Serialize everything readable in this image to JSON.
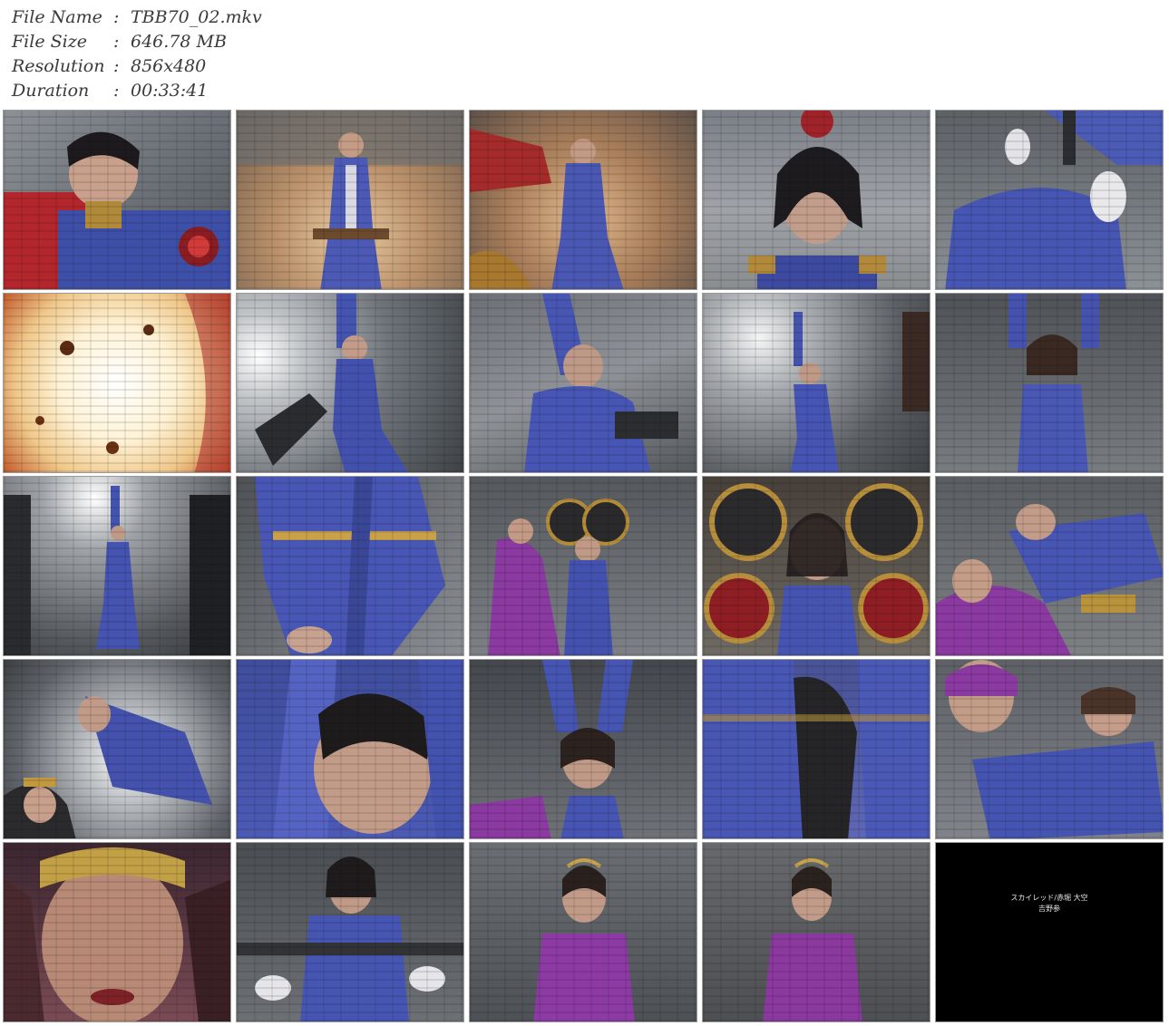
{
  "file_info": {
    "name_label": "File Name",
    "name_value": "TBB70_02.mkv",
    "size_label": "File Size",
    "size_value": "646.78 MB",
    "resolution_label": "Resolution",
    "resolution_value": "856x480",
    "duration_label": "Duration",
    "duration_value": "00:33:41",
    "separator": ":"
  },
  "final_frame_credit": {
    "line1": "スカイレッド/赤堀 大空",
    "line2": "吉野参"
  },
  "colors": {
    "suit_blue": "#4a5ab8",
    "villain_purple": "#8a3aa0",
    "villain_red": "#b02828",
    "wall_gray": "#6b6e72",
    "background_white": "#ffffff",
    "black_frame": "#000000"
  }
}
